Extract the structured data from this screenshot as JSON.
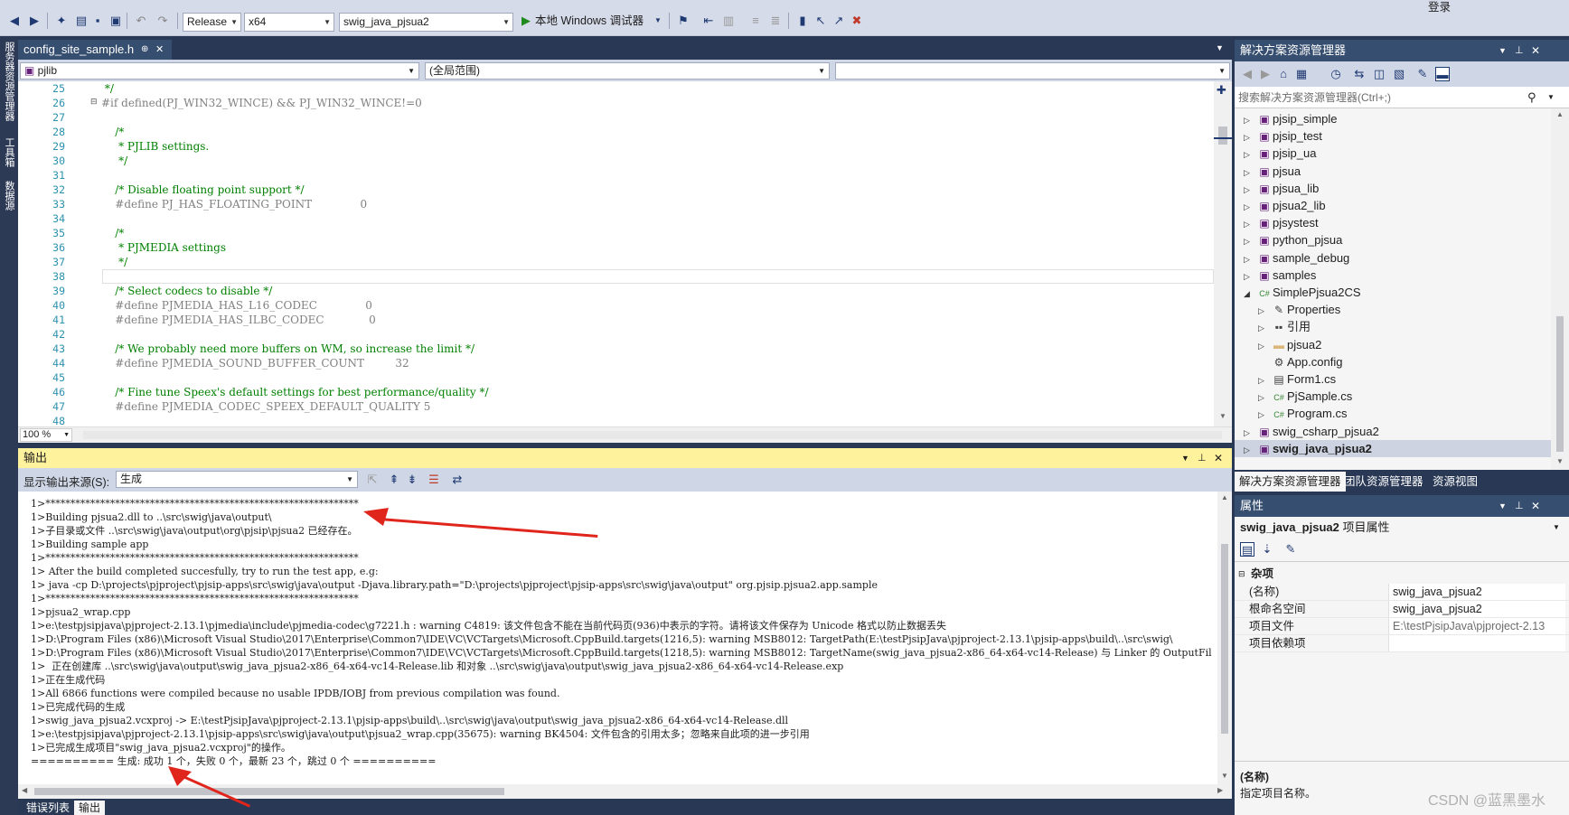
{
  "toolbar": {
    "config": "Release",
    "platform": "x64",
    "startup_project": "swig_java_pjsua2",
    "run_label": "本地 Windows 调试器",
    "top_right_label": "登录"
  },
  "left_tabs": [
    "服务器资源管理器",
    "工具箱",
    "数据源"
  ],
  "editor": {
    "tab": "config_site_sample.h",
    "tab_pin": "⊕",
    "tab_close": "✕",
    "nav_project": "pjlib",
    "nav_scope": "(全局范围)",
    "nav_member": "",
    "zoom": "100 %",
    "lines": [
      {
        "n": "25",
        "text": " */",
        "cls": "cmt"
      },
      {
        "n": "26",
        "text": "#if defined(PJ_WIN32_WINCE) && PJ_WIN32_WINCE!=0",
        "cls": "pp"
      },
      {
        "n": "27",
        "text": "",
        "cls": ""
      },
      {
        "n": "28",
        "text": "    /*",
        "cls": "cmt"
      },
      {
        "n": "29",
        "text": "     * PJLIB settings.",
        "cls": "cmt"
      },
      {
        "n": "30",
        "text": "     */",
        "cls": "cmt"
      },
      {
        "n": "31",
        "text": "",
        "cls": ""
      },
      {
        "n": "32",
        "text": "    /* Disable floating point support */",
        "cls": "cmt"
      },
      {
        "n": "33",
        "text": "    #define PJ_HAS_FLOATING_POINT              0",
        "cls": "pp"
      },
      {
        "n": "34",
        "text": "",
        "cls": ""
      },
      {
        "n": "35",
        "text": "    /*",
        "cls": "cmt"
      },
      {
        "n": "36",
        "text": "     * PJMEDIA settings",
        "cls": "cmt"
      },
      {
        "n": "37",
        "text": "     */",
        "cls": "cmt"
      },
      {
        "n": "38",
        "text": "",
        "cls": ""
      },
      {
        "n": "39",
        "text": "    /* Select codecs to disable */",
        "cls": "cmt"
      },
      {
        "n": "40",
        "text": "    #define PJMEDIA_HAS_L16_CODEC              0",
        "cls": "pp"
      },
      {
        "n": "41",
        "text": "    #define PJMEDIA_HAS_ILBC_CODEC             0",
        "cls": "pp"
      },
      {
        "n": "42",
        "text": "",
        "cls": ""
      },
      {
        "n": "43",
        "text": "    /* We probably need more buffers on WM, so increase the limit */",
        "cls": "cmt"
      },
      {
        "n": "44",
        "text": "    #define PJMEDIA_SOUND_BUFFER_COUNT         32",
        "cls": "pp"
      },
      {
        "n": "45",
        "text": "",
        "cls": ""
      },
      {
        "n": "46",
        "text": "    /* Fine tune Speex's default settings for best performance/quality */",
        "cls": "cmt"
      },
      {
        "n": "47",
        "text": "    #define PJMEDIA_CODEC_SPEEX_DEFAULT_QUALITY 5",
        "cls": "pp"
      },
      {
        "n": "48",
        "text": "",
        "cls": ""
      }
    ]
  },
  "output": {
    "title": "输出",
    "source_label": "显示输出来源(S):",
    "source_value": "生成",
    "lines": [
      "1>***************************************************************",
      "1>Building pjsua2.dll to ..\\src\\swig\\java\\output\\",
      "1>子目录或文件 ..\\src\\swig\\java\\output\\org\\pjsip\\pjsua2 已经存在。",
      "1>Building sample app",
      "1>***************************************************************",
      "1> After the build completed succesfully, try to run the test app, e.g:",
      "1> java -cp D:\\projects\\pjproject\\pjsip-apps\\src\\swig\\java\\output -Djava.library.path=\"D:\\projects\\pjproject\\pjsip-apps\\src\\swig\\java\\output\" org.pjsip.pjsua2.app.sample",
      "1>***************************************************************",
      "1>pjsua2_wrap.cpp",
      "1>e:\\testpjsipjava\\pjproject-2.13.1\\pjmedia\\include\\pjmedia-codec\\g7221.h : warning C4819: 该文件包含不能在当前代码页(936)中表示的字符。请将该文件保存为 Unicode 格式以防止数据丢失",
      "1>D:\\Program Files (x86)\\Microsoft Visual Studio\\2017\\Enterprise\\Common7\\IDE\\VC\\VCTargets\\Microsoft.CppBuild.targets(1216,5): warning MSB8012: TargetPath(E:\\testPjsipJava\\pjproject-2.13.1\\pjsip-apps\\build\\..\\src\\swig\\",
      "1>D:\\Program Files (x86)\\Microsoft Visual Studio\\2017\\Enterprise\\Common7\\IDE\\VC\\VCTargets\\Microsoft.CppBuild.targets(1218,5): warning MSB8012: TargetName(swig_java_pjsua2-x86_64-x64-vc14-Release) 与 Linker 的 OutputFil",
      "1>  正在创建库 ..\\src\\swig\\java\\output\\swig_java_pjsua2-x86_64-x64-vc14-Release.lib 和对象 ..\\src\\swig\\java\\output\\swig_java_pjsua2-x86_64-x64-vc14-Release.exp",
      "1>正在生成代码",
      "1>All 6866 functions were compiled because no usable IPDB/IOBJ from previous compilation was found.",
      "1>已完成代码的生成",
      "1>swig_java_pjsua2.vcxproj -> E:\\testPjsipJava\\pjproject-2.13.1\\pjsip-apps\\build\\..\\src\\swig\\java\\output\\swig_java_pjsua2-x86_64-x64-vc14-Release.dll",
      "1>e:\\testpjsipjava\\pjproject-2.13.1\\pjsip-apps\\src\\swig\\java\\output\\pjsua2_wrap.cpp(35675): warning BK4504: 文件包含的引用太多；忽略来自此项的进一步引用",
      "1>已完成生成项目\"swig_java_pjsua2.vcxproj\"的操作。",
      "========== 生成: 成功 1 个，失败 0 个，最新 23 个，跳过 0 个 =========="
    ]
  },
  "bottom_tabs": [
    "错误列表",
    "输出"
  ],
  "solution_explorer": {
    "title": "解决方案资源管理器",
    "search_placeholder": "搜索解决方案资源管理器(Ctrl+;)",
    "items": [
      {
        "label": "pjsip_simple",
        "indent": 0,
        "tri": "▷",
        "icon": "project-icon",
        "sel": false
      },
      {
        "label": "pjsip_test",
        "indent": 0,
        "tri": "▷",
        "icon": "project-icon",
        "sel": false
      },
      {
        "label": "pjsip_ua",
        "indent": 0,
        "tri": "▷",
        "icon": "project-icon",
        "sel": false
      },
      {
        "label": "pjsua",
        "indent": 0,
        "tri": "▷",
        "icon": "project-icon",
        "sel": false
      },
      {
        "label": "pjsua_lib",
        "indent": 0,
        "tri": "▷",
        "icon": "project-icon",
        "sel": false
      },
      {
        "label": "pjsua2_lib",
        "indent": 0,
        "tri": "▷",
        "icon": "project-icon",
        "sel": false
      },
      {
        "label": "pjsystest",
        "indent": 0,
        "tri": "▷",
        "icon": "project-icon",
        "sel": false
      },
      {
        "label": "python_pjsua",
        "indent": 0,
        "tri": "▷",
        "icon": "project-icon",
        "sel": false
      },
      {
        "label": "sample_debug",
        "indent": 0,
        "tri": "▷",
        "icon": "project-icon",
        "sel": false
      },
      {
        "label": "samples",
        "indent": 0,
        "tri": "▷",
        "icon": "project-icon",
        "sel": false
      },
      {
        "label": "SimplePjsua2CS",
        "indent": 0,
        "tri": "◢",
        "icon": "csharp-project-icon",
        "sel": false
      },
      {
        "label": "Properties",
        "indent": 1,
        "tri": "▷",
        "icon": "wrench-icon",
        "sel": false
      },
      {
        "label": "引用",
        "indent": 1,
        "tri": "▷",
        "icon": "references-icon",
        "sel": false
      },
      {
        "label": "pjsua2",
        "indent": 1,
        "tri": "▷",
        "icon": "folder-icon",
        "sel": false
      },
      {
        "label": "App.config",
        "indent": 1,
        "tri": "",
        "icon": "config-file-icon",
        "sel": false
      },
      {
        "label": "Form1.cs",
        "indent": 1,
        "tri": "▷",
        "icon": "form-icon",
        "sel": false
      },
      {
        "label": "PjSample.cs",
        "indent": 1,
        "tri": "▷",
        "icon": "csharp-file-icon",
        "sel": false
      },
      {
        "label": "Program.cs",
        "indent": 1,
        "tri": "▷",
        "icon": "csharp-file-icon",
        "sel": false
      },
      {
        "label": "swig_csharp_pjsua2",
        "indent": 0,
        "tri": "▷",
        "icon": "project-icon",
        "sel": false
      },
      {
        "label": "swig_java_pjsua2",
        "indent": 0,
        "tri": "▷",
        "icon": "project-icon",
        "sel": true
      }
    ],
    "tabs": [
      "解决方案资源管理器",
      "团队资源管理器",
      "资源视图"
    ]
  },
  "properties": {
    "title": "属性",
    "object": "swig_java_pjsua2",
    "object_suffix": "项目属性",
    "category": "杂项",
    "rows": [
      {
        "k": "(名称)",
        "v": "swig_java_pjsua2"
      },
      {
        "k": "根命名空间",
        "v": "swig_java_pjsua2"
      },
      {
        "k": "项目文件",
        "v": "E:\\testPjsipJava\\pjproject-2.13"
      },
      {
        "k": "项目依赖项",
        "v": ""
      }
    ],
    "desc_title": "(名称)",
    "desc_text": "指定项目名称。"
  },
  "watermark": "CSDN @蓝黑墨水",
  "colors": {
    "annotation_arrow": "#e0261c",
    "vs_blue": "#293955",
    "output_header": "#fff29d"
  }
}
